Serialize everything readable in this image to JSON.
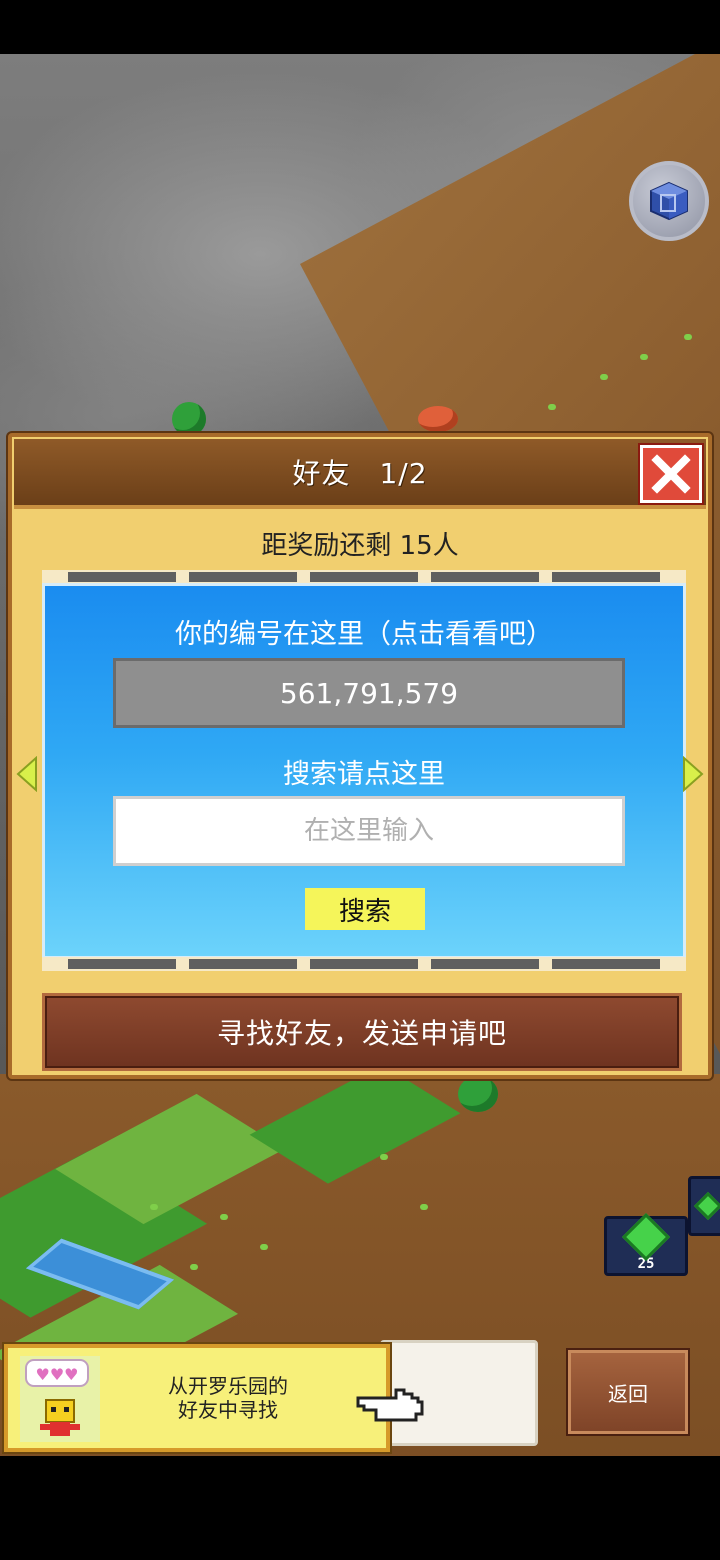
{
  "dialog": {
    "title": "好友　1/2",
    "reward_text": "距奖励还剩 15人",
    "id_caption": "你的编号在这里（点击看看吧）",
    "player_id": "561,791,579",
    "search_caption": "搜索请点这里",
    "search_placeholder": "在这里输入",
    "search_button": "搜索",
    "find_button": "寻找好友，发送申请吧"
  },
  "tip": {
    "text": "从开罗乐园的\n好友中寻找"
  },
  "back_button": "返回",
  "gem_count": "25",
  "colors": {
    "panel_blue": "#1a8cf0",
    "close_red": "#e04a3a",
    "search_yellow": "#f5f55a"
  },
  "icons": [
    "cube-view-icon",
    "close-icon",
    "arrow-left-icon",
    "arrow-right-icon",
    "hand-pointer-icon",
    "gem-icon",
    "robot-avatar-icon"
  ]
}
